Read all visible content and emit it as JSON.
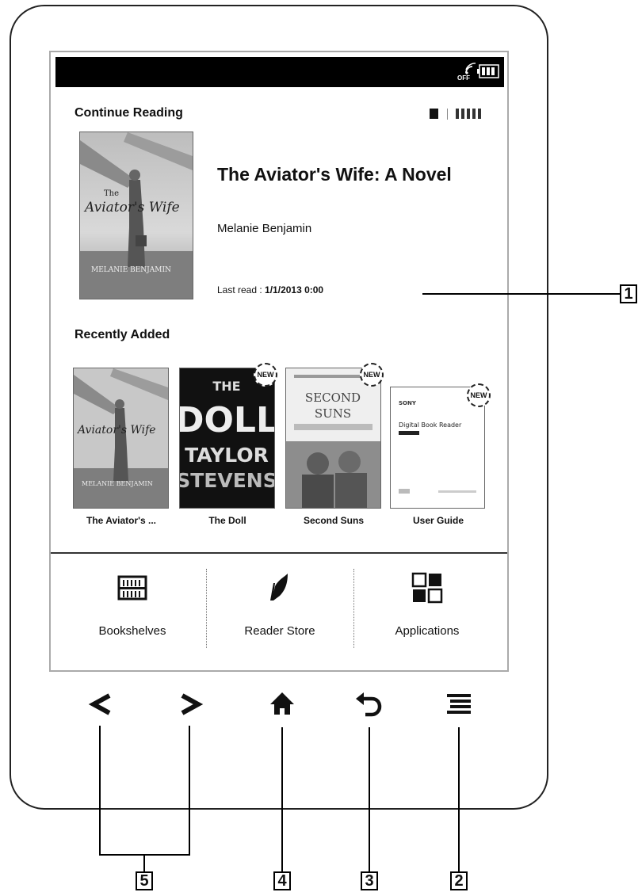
{
  "continue_reading": {
    "section_title": "Continue Reading",
    "book_title": "The Aviator's Wife: A Novel",
    "author": "Melanie Benjamin",
    "last_read_label": "Last read : ",
    "last_read_value": "1/1/2013 0:00",
    "cover": {
      "title_line1": "The",
      "title_line2": "Aviator's Wife",
      "author": "MELANIE BENJAMIN"
    }
  },
  "recently_added": {
    "section_title": "Recently Added",
    "books": [
      {
        "label": "The Aviator's ...",
        "is_new": false,
        "cover_title": "Aviator's Wife",
        "cover_author": "MELANIE BENJAMIN"
      },
      {
        "label": "The Doll",
        "is_new": true,
        "badge": "NEW",
        "cover_lines": [
          "THE",
          "DOLL",
          "TAYLOR",
          "STEVENS"
        ]
      },
      {
        "label": "Second Suns",
        "is_new": true,
        "badge": "NEW",
        "cover_lines": [
          "SECOND",
          "SUNS"
        ]
      },
      {
        "label": "User Guide",
        "is_new": true,
        "badge": "NEW",
        "cover_lines": [
          "SONY",
          "Digital Book Reader"
        ]
      }
    ]
  },
  "status_bar": {
    "wifi_state": "OFF",
    "icons": [
      "wifi-off-icon",
      "battery-icon"
    ]
  },
  "bottom_menu": [
    {
      "label": "Bookshelves",
      "icon": "bookshelf-icon"
    },
    {
      "label": "Reader Store",
      "icon": "reader-store-icon"
    },
    {
      "label": "Applications",
      "icon": "applications-grid-icon"
    }
  ],
  "hardware_buttons": [
    "prev-page-icon",
    "next-page-icon",
    "home-icon",
    "back-icon",
    "menu-icon"
  ],
  "callouts": [
    "1",
    "2",
    "3",
    "4",
    "5"
  ],
  "colors": {
    "status_bar": "#000000",
    "device_frame": "#222222",
    "screen_border": "#aaaaaa"
  }
}
